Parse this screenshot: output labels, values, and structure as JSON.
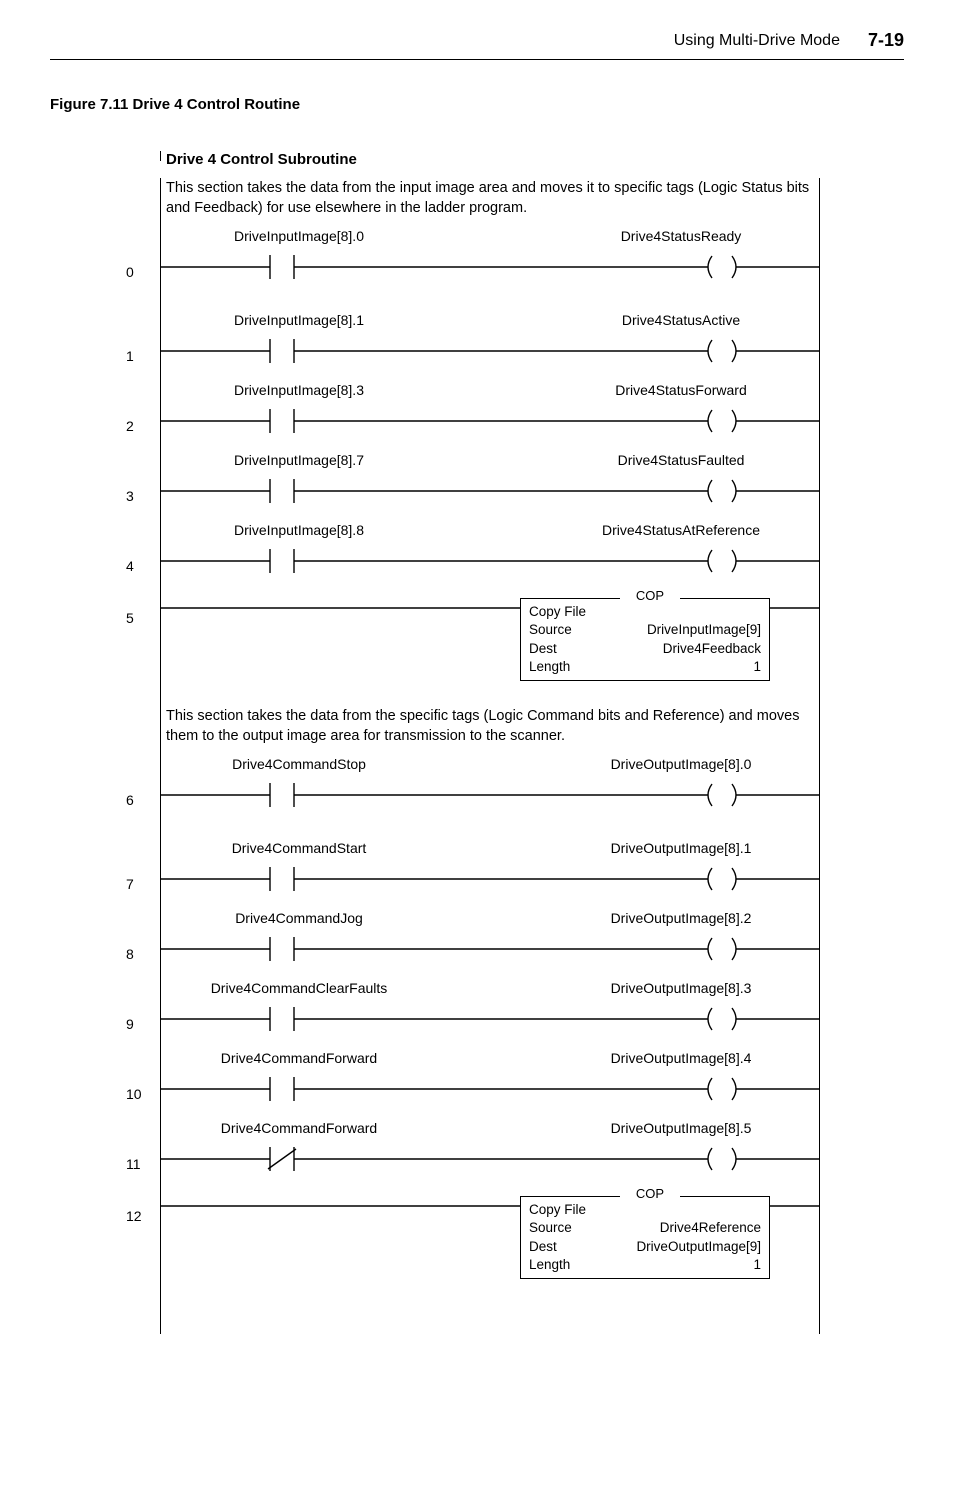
{
  "header": {
    "title": "Using Multi-Drive Mode",
    "page": "7-19"
  },
  "caption": "Figure 7.11   Drive 4 Control Routine",
  "subroutine_title": "Drive 4 Control Subroutine",
  "desc1": "This section takes the data from the input image area and moves it to specific tags (Logic Status bits and Feedback) for use elsewhere in the ladder program.",
  "rungs_a": [
    {
      "n": "0",
      "left": "DriveInputImage[8].0",
      "right": "Drive4StatusReady"
    },
    {
      "n": "1",
      "left": "DriveInputImage[8].1",
      "right": "Drive4StatusActive"
    },
    {
      "n": "2",
      "left": "DriveInputImage[8].3",
      "right": "Drive4StatusForward"
    },
    {
      "n": "3",
      "left": "DriveInputImage[8].7",
      "right": "Drive4StatusFaulted"
    },
    {
      "n": "4",
      "left": "DriveInputImage[8].8",
      "right": "Drive4StatusAtReference"
    }
  ],
  "cop1": {
    "n": "5",
    "title": "COP",
    "l0": "Copy File",
    "l1a": "Source",
    "l1b": "DriveInputImage[9]",
    "l2a": "Dest",
    "l2b": "Drive4Feedback",
    "l3a": "Length",
    "l3b": "1"
  },
  "desc2": "This section takes the data from the specific tags (Logic Command bits and Reference) and moves them to the output image area for transmission to the scanner.",
  "rungs_b": [
    {
      "n": "6",
      "left": "Drive4CommandStop",
      "right": "DriveOutputImage[8].0",
      "nc": false
    },
    {
      "n": "7",
      "left": "Drive4CommandStart",
      "right": "DriveOutputImage[8].1",
      "nc": false
    },
    {
      "n": "8",
      "left": "Drive4CommandJog",
      "right": "DriveOutputImage[8].2",
      "nc": false
    },
    {
      "n": "9",
      "left": "Drive4CommandClearFaults",
      "right": "DriveOutputImage[8].3",
      "nc": false
    },
    {
      "n": "10",
      "left": "Drive4CommandForward",
      "right": "DriveOutputImage[8].4",
      "nc": false
    },
    {
      "n": "11",
      "left": "Drive4CommandForward",
      "right": "DriveOutputImage[8].5",
      "nc": true
    }
  ],
  "cop2": {
    "n": "12",
    "title": "COP",
    "l0": "Copy File",
    "l1a": "Source",
    "l1b": "Drive4Reference",
    "l2a": "Dest",
    "l2b": "DriveOutputImage[9]",
    "l3a": "Length",
    "l3b": "1"
  }
}
